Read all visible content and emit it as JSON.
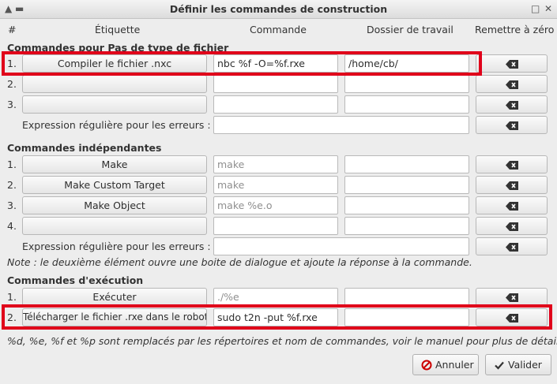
{
  "window": {
    "title": "Définir les commandes de construction"
  },
  "columns": {
    "num": "#",
    "label": "Étiquette",
    "command": "Commande",
    "workdir": "Dossier de travail",
    "reset": "Remettre à zéro"
  },
  "filetype": {
    "header": "Commandes pour Pas de type de fichier",
    "rows": [
      {
        "num": "1.",
        "label": "Compiler le fichier .nxc",
        "command": "nbc %f -O=%f.rxe",
        "workdir": "/home/cb/"
      },
      {
        "num": "2.",
        "label": "",
        "command": "",
        "workdir": ""
      },
      {
        "num": "3.",
        "label": "",
        "command": "",
        "workdir": ""
      }
    ],
    "regex_label": "Expression régulière pour les erreurs :",
    "regex_value": ""
  },
  "independent": {
    "header": "Commandes indépendantes",
    "rows": [
      {
        "num": "1.",
        "label": "Make",
        "command": "make",
        "workdir": ""
      },
      {
        "num": "2.",
        "label": "Make Custom Target",
        "command": "make",
        "workdir": ""
      },
      {
        "num": "3.",
        "label": "Make Object",
        "command": "make %e.o",
        "workdir": ""
      },
      {
        "num": "4.",
        "label": "",
        "command": "",
        "workdir": ""
      }
    ],
    "regex_label": "Expression régulière pour les erreurs :",
    "regex_value": "",
    "note": "Note : le deuxième élément ouvre une boite de dialogue et ajoute la réponse à la commande."
  },
  "execute": {
    "header": "Commandes d'exécution",
    "rows": [
      {
        "num": "1.",
        "label": "Exécuter",
        "command": "./%e",
        "workdir": ""
      },
      {
        "num": "2.",
        "label": "Télécharger le fichier .rxe dans le robot",
        "command": "sudo t2n -put %f.rxe",
        "workdir": ""
      }
    ]
  },
  "footer_note": "%d, %e, %f et %p sont remplacés par les répertoires et nom de commandes, voir le manuel pour plus de détails.",
  "buttons": {
    "cancel": "Annuler",
    "ok": "Valider"
  },
  "colors": {
    "highlight": "#e0001a",
    "cancel_icon": "#cc0000",
    "ok_icon": "#333333"
  }
}
